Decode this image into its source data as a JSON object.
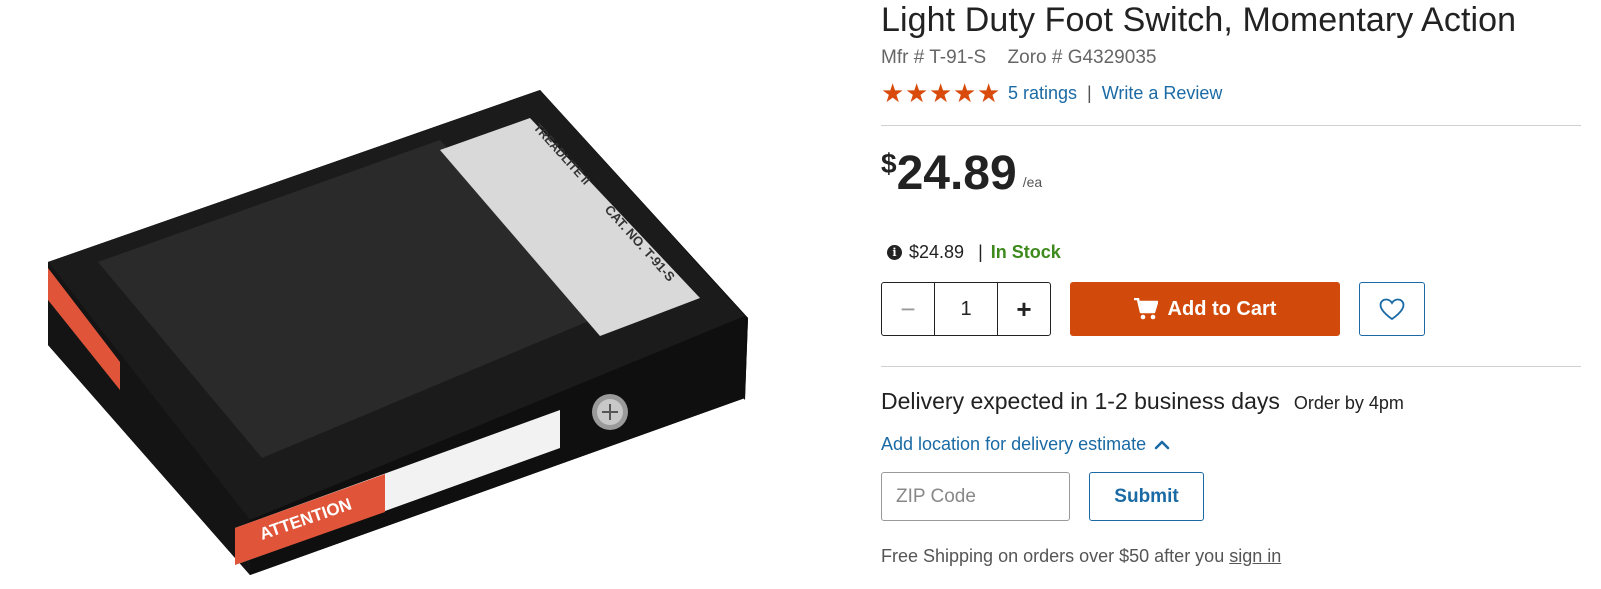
{
  "product": {
    "title": "Light Duty Foot Switch, Momentary Action",
    "mfr": "Mfr # T-91-S",
    "zoro": "Zoro # G4329035",
    "image_alt": "Black foot switch pedal with label",
    "image_label": {
      "brand": "TREADLITE II",
      "cat": "CAT. NO. T-91-S",
      "warning": "ATTENTION"
    }
  },
  "rating": {
    "stars": 5,
    "count_label": "5 ratings",
    "separator": "|",
    "write_review": "Write a Review",
    "star_color": "#d84b0c"
  },
  "price": {
    "currency": "$",
    "amount": "24.89",
    "unit": "/ea"
  },
  "stock": {
    "info_icon": "i",
    "price": "$24.89",
    "separator": "|",
    "status": "In Stock"
  },
  "cart": {
    "quantity": "1",
    "minus": "−",
    "plus": "+",
    "add_label": "Add to Cart",
    "accent": "#d14a0b"
  },
  "delivery": {
    "heading": "Delivery expected in 1-2 business days",
    "order_by": "Order by 4pm",
    "add_location": "Add location for delivery estimate",
    "zip_placeholder": "ZIP Code",
    "submit": "Submit",
    "free_shipping_prefix": "Free Shipping on orders over $50 after you ",
    "sign_in": "sign in"
  }
}
